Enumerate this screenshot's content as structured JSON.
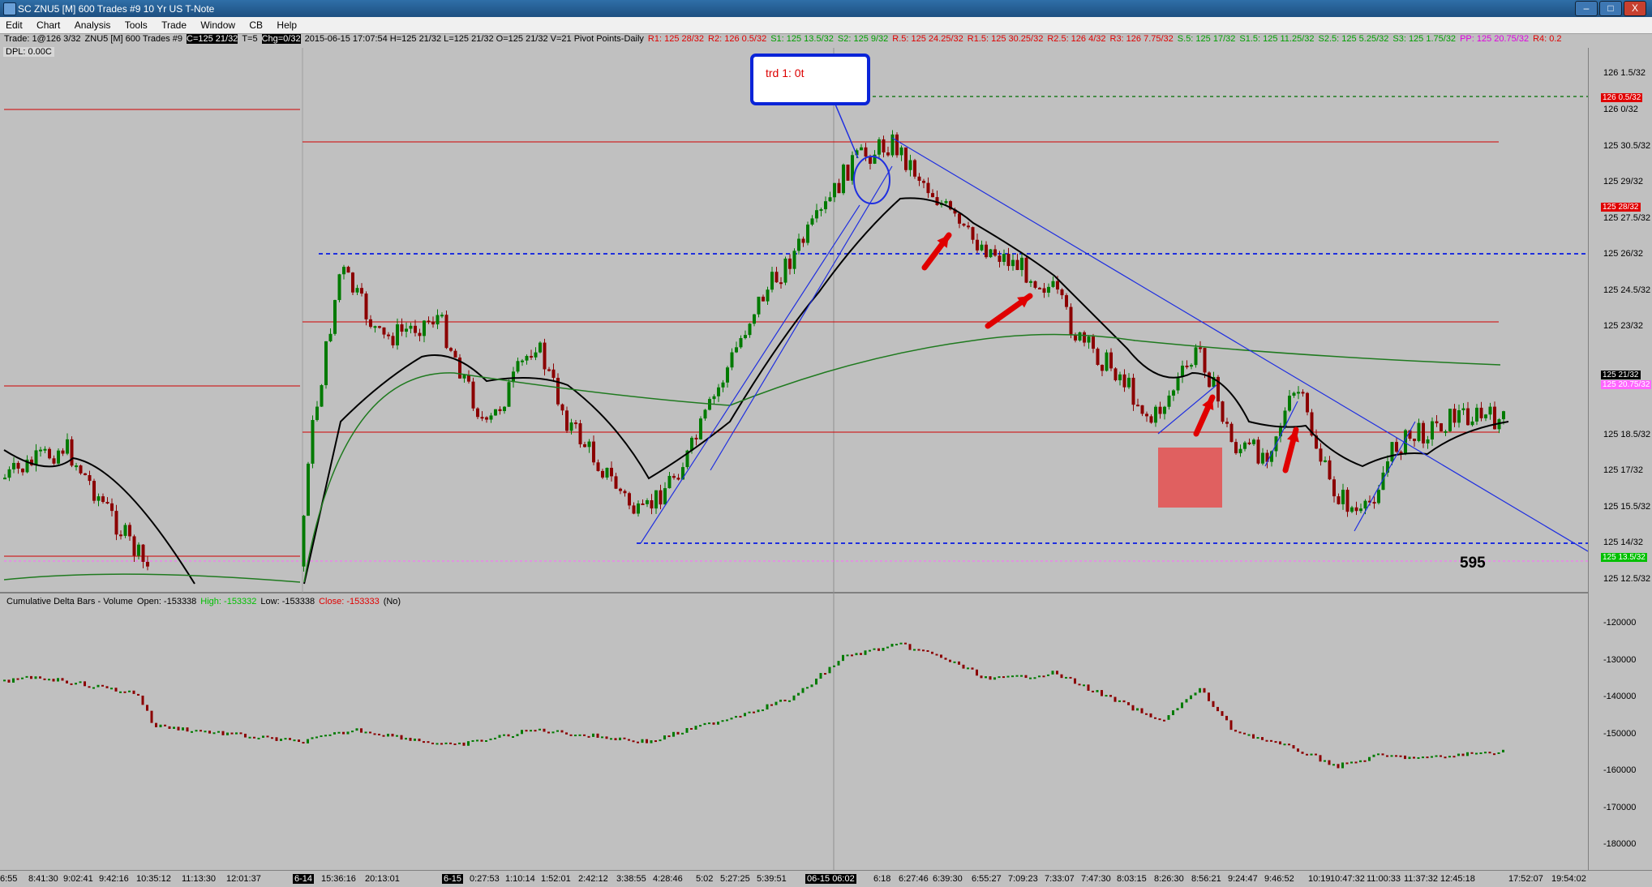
{
  "window": {
    "title": "SC ZNU5 [M]  600 Trades  #9  10 Yr US T-Note",
    "minimize": "–",
    "maximize": "□",
    "close": "X"
  },
  "menu": [
    "Edit",
    "Chart",
    "Analysis",
    "Tools",
    "Trade",
    "Window",
    "CB",
    "Help"
  ],
  "info": {
    "trade": "Trade: 1@126 3/32",
    "symbol": "ZNU5 [M]  600 Trades  #9",
    "close": "C=125 21/32",
    "t": "T=5",
    "chg": "Chg=0/32",
    "stats": "2015-06-15 17:07:54  H=125 21/32  L=125 21/32  O=125 21/32  V=21  Pivot Points-Daily",
    "r1": "R1: 125 28/32",
    "r2": "R2: 126 0.5/32",
    "s1": "S1: 125 13.5/32",
    "s2": "S2: 125 9/32",
    "r5": "R.5: 125 24.25/32",
    "r15": "R1.5: 125 30.25/32",
    "r25": "R2.5: 126 4/32",
    "r3": "R3: 126 7.75/32",
    "s5": "S.5: 125 17/32",
    "s15": "S1.5: 125 11.25/32",
    "s25": "S2.5: 125 5.25/32",
    "s3": "S3: 125 1.75/32",
    "pp": "PP: 125 20.75/32",
    "r4": "R4: 0.2",
    "dpl": "DPL: 0.00C"
  },
  "annotation": {
    "trade_box": "trd 1: 0t",
    "count": "595"
  },
  "cd_study": {
    "name": "Cumulative Delta Bars - Volume",
    "open": "Open: -153338",
    "high": "High: -153332",
    "low": "Low: -153338",
    "close": "Close: -153333",
    "extra": "(No)"
  },
  "price_axis": [
    "126 1.5/32",
    "126 0/32",
    "125 30.5/32",
    "125 29/32",
    "125 27.5/32",
    "125 26/32",
    "125 24.5/32",
    "125 23/32",
    "125 18.5/32",
    "125 17/32",
    "125 15.5/32",
    "125 14/32",
    "125 12.5/32"
  ],
  "price_tags": [
    {
      "text": "126 0.5/32",
      "bg": "#e00000",
      "fg": "#ffffff"
    },
    {
      "text": "125 28/32",
      "bg": "#e00000",
      "fg": "#ffffff"
    },
    {
      "text": "125 21/32",
      "bg": "#000000",
      "fg": "#ffffff"
    },
    {
      "text": "125 20.75/32",
      "bg": "#ff66ff",
      "fg": "#ffffff"
    },
    {
      "text": "125 13.5/32",
      "bg": "#00c000",
      "fg": "#ffffff"
    }
  ],
  "cd_axis": [
    "-120000",
    "-130000",
    "-140000",
    "-150000",
    "-160000",
    "-170000",
    "-180000"
  ],
  "time_axis": [
    "6:55",
    "8:41:30",
    "9:02:41",
    "9:42:16",
    "10:35:12",
    "11:13:30",
    "12:01:37",
    "6-14",
    "15:36:16",
    "20:13:01",
    "6-15",
    "0:27:53",
    "1:10:14",
    "1:52:01",
    "2:42:12",
    "3:38:55",
    "4:28:46",
    "5:02",
    "5:27:25",
    "5:39:51",
    "06-15 06:02",
    "6:18",
    "6:27:46",
    "6:39:30",
    "6:55:27",
    "7:09:23",
    "7:33:07",
    "7:47:30",
    "8:03:15",
    "8:26:30",
    "8:56:21",
    "9:24:47",
    "9:46:52",
    "10:19",
    "10:47:32",
    "11:00:33",
    "11:37:32",
    "12:45:18",
    "17:52:07",
    "19:54:02"
  ],
  "colors": {
    "background": "#c0c0c0",
    "up_bar": "#007a00",
    "down_bar": "#8b0000",
    "pivot_line": "#d00000",
    "trend_line": "#1f2fe0",
    "ma_short": "#000000",
    "ma_long": "#1f7a1f",
    "pink_line": "#ff66ff",
    "red_zone": "#e06060"
  }
}
